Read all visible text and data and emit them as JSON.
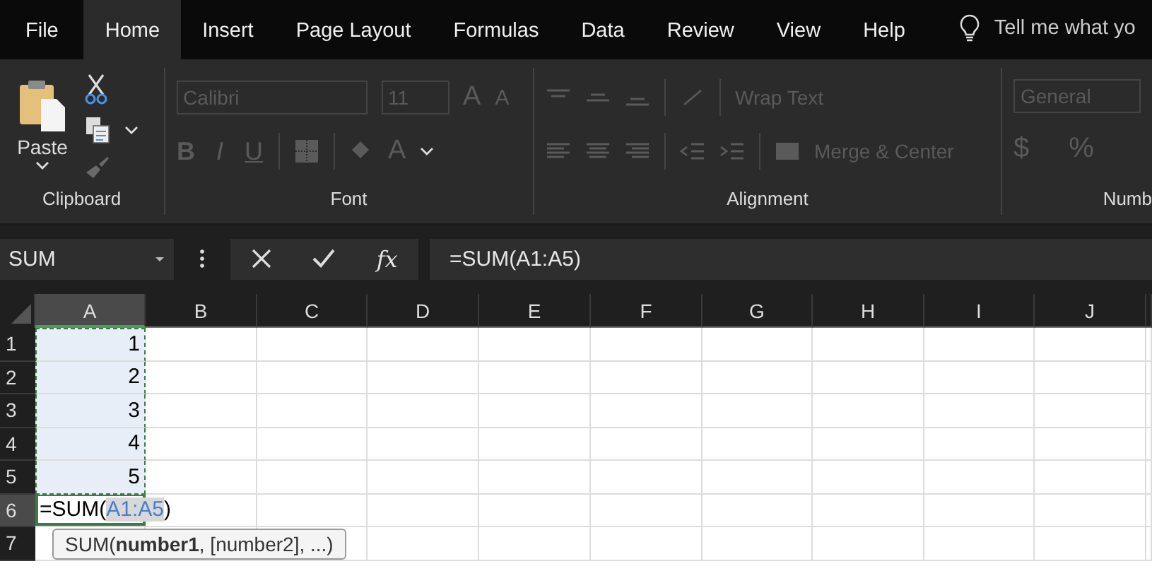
{
  "menu": {
    "tabs": [
      {
        "label": "File",
        "selected": false
      },
      {
        "label": "Home",
        "selected": true
      },
      {
        "label": "Insert",
        "selected": false
      },
      {
        "label": "Page Layout",
        "selected": false
      },
      {
        "label": "Formulas",
        "selected": false
      },
      {
        "label": "Data",
        "selected": false
      },
      {
        "label": "Review",
        "selected": false
      },
      {
        "label": "View",
        "selected": false
      },
      {
        "label": "Help",
        "selected": false
      }
    ],
    "tell_me": "Tell me what yo"
  },
  "ribbon": {
    "groups": [
      {
        "kind": "clipboard",
        "label": "Clipboard",
        "disabled": false,
        "paste_label": "Paste"
      },
      {
        "kind": "font",
        "label": "Font",
        "disabled": true,
        "font_name": "Calibri",
        "font_size": "11",
        "styles": [
          "B",
          "I",
          "U"
        ],
        "grow_letter": "A",
        "shrink_letter": "A",
        "color_letter": "A"
      },
      {
        "kind": "alignment",
        "label": "Alignment",
        "disabled": true,
        "wrap_text": "Wrap Text",
        "merge": "Merge & Center"
      },
      {
        "kind": "number",
        "label": "Numb",
        "disabled": true,
        "format": "General",
        "currency": "$",
        "percent": "%"
      }
    ]
  },
  "formula_bar": {
    "name_box": "SUM",
    "fx": "fx",
    "formula": "=SUM(A1:A5)"
  },
  "sheet": {
    "columns": [
      {
        "label": "A",
        "selected": true
      },
      {
        "label": "B",
        "selected": false
      },
      {
        "label": "C",
        "selected": false
      },
      {
        "label": "D",
        "selected": false
      },
      {
        "label": "E",
        "selected": false
      },
      {
        "label": "F",
        "selected": false
      },
      {
        "label": "G",
        "selected": false
      },
      {
        "label": "H",
        "selected": false
      },
      {
        "label": "I",
        "selected": false
      },
      {
        "label": "J",
        "selected": false
      }
    ],
    "rows": [
      {
        "label": "1",
        "selected": false,
        "in_range": true,
        "value": "1"
      },
      {
        "label": "2",
        "selected": false,
        "in_range": true,
        "value": "2"
      },
      {
        "label": "3",
        "selected": false,
        "in_range": true,
        "value": "3"
      },
      {
        "label": "4",
        "selected": false,
        "in_range": true,
        "value": "4"
      },
      {
        "label": "5",
        "selected": false,
        "in_range": true,
        "value": "5"
      },
      {
        "label": "6",
        "selected": true,
        "in_range": false
      },
      {
        "label": "7",
        "selected": false,
        "in_range": false
      }
    ],
    "edit_cell": {
      "prefix": "=SUM(",
      "reference": "A1:A5",
      "suffix": ")"
    },
    "tooltip": "SUM(**number1**, [number2], ...)"
  }
}
